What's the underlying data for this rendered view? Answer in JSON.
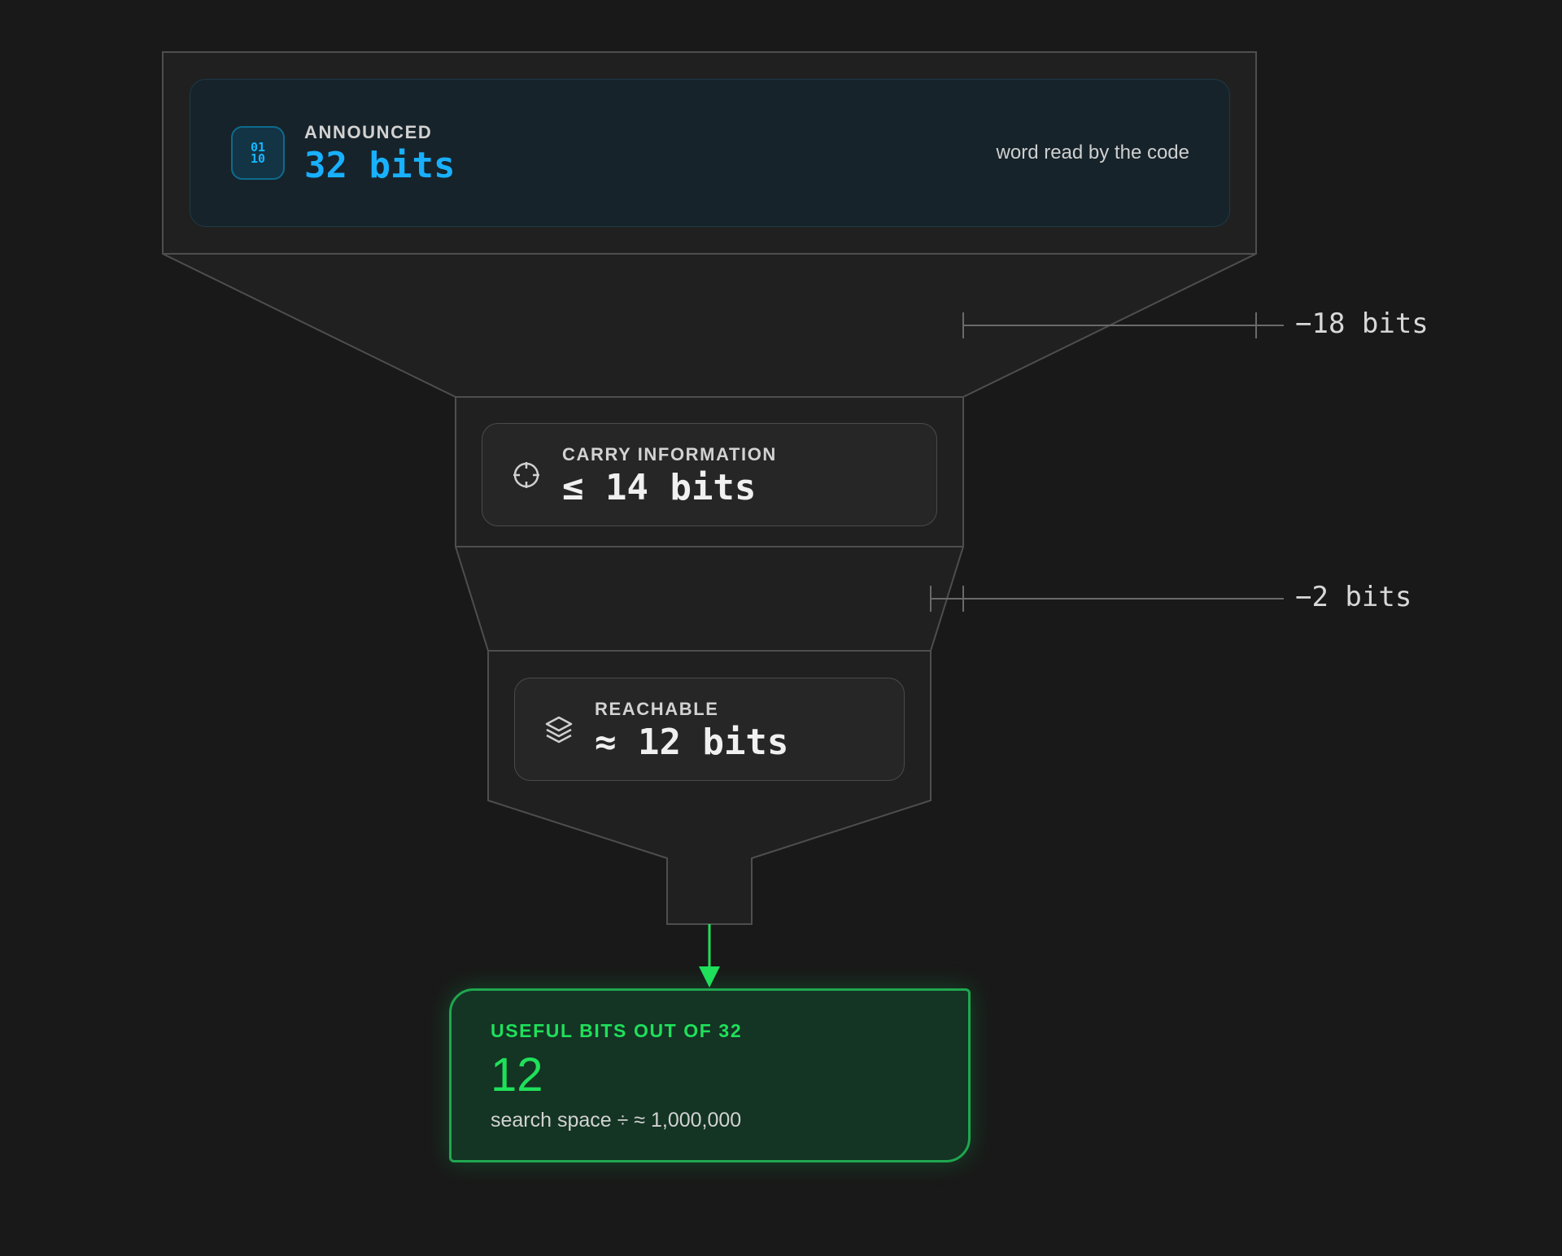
{
  "stages": [
    {
      "id": "announced",
      "label": "ANNOUNCED",
      "value": "32 bits",
      "note": "word read by the code",
      "icon": "binary-icon",
      "icon_text": "01\n10",
      "accent": "#18b0ff"
    },
    {
      "id": "carry",
      "label": "CARRY INFORMATION",
      "value": "≤ 14 bits",
      "icon": "crosshair-icon"
    },
    {
      "id": "reachable",
      "label": "REACHABLE",
      "value": "≈ 12 bits",
      "icon": "layers-icon"
    }
  ],
  "drops": [
    {
      "label": "−18 bits"
    },
    {
      "label": "−2 bits"
    }
  ],
  "result": {
    "label": "USEFUL BITS OUT OF 32",
    "value": "12",
    "note": "search space ÷ ≈ 1,000,000",
    "accent": "#1fe05a"
  }
}
